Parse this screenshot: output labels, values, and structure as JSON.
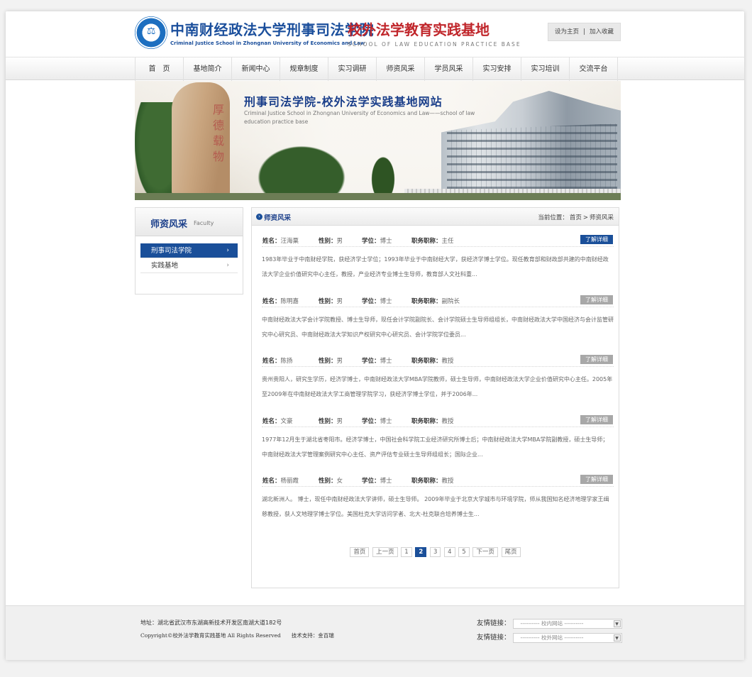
{
  "header": {
    "logo_cn": "中南财经政法大学刑事司法学院",
    "logo_cn_sub": "校外法学教育实践基地",
    "logo_en": "Criminal Justice School in Zhongnan University of Economics and Law",
    "logo_en_sub": "SCHOOL OF LAW EDUCATION PRACTICE BASE",
    "set_home": "设为主页",
    "separator": "|",
    "favorite": "加入收藏"
  },
  "nav": [
    "首　页",
    "基地简介",
    "新闻中心",
    "规章制度",
    "实习调研",
    "师资风采",
    "学员风采",
    "实习安排",
    "实习培训",
    "交流平台"
  ],
  "banner": {
    "title": "刑事司法学院-校外法学实践基地网站",
    "subtitle": "Criminal Justice School in Zhongnan University of Economics and Law——school of law education practice base",
    "rock_text": "厚德载物"
  },
  "sidebar": {
    "title": "师资风采",
    "title_en": "Faculty",
    "items": [
      {
        "label": "刑事司法学院",
        "arrow": "›"
      },
      {
        "label": "实践基地",
        "arrow": "›"
      }
    ]
  },
  "main": {
    "title": "师资风采",
    "breadcrumb_prefix": "当前位置：",
    "breadcrumb_home": "首页",
    "breadcrumb_sep": ">",
    "breadcrumb_current": "师资风采",
    "labels": {
      "name": "姓名：",
      "gender": "性别：",
      "degree": "学位：",
      "title": "职务职称："
    },
    "detail_label": "了解详细",
    "entries": [
      {
        "name": "汪海粟",
        "gender": "男",
        "degree": "博士",
        "title": "主任",
        "desc": "1983年毕业于中南财经学院，获经济学士学位；1993年毕业于中南财经大学，获经济学博士学位。现任教育部和财政部共建的中南财经政法大学企业价值研究中心主任，教授，产业经济专业博士生导师，教育部人文社科重..."
      },
      {
        "name": "陈明嘉",
        "gender": "男",
        "degree": "博士",
        "title": "副院长",
        "desc": "中南财经政法大学会计学院教授、博士生导师，现任会计学院副院长、会计学院硕士生导师组组长，中南财经政法大学中国经济与会计监管研究中心研究员、中南财经政法大学知识产权研究中心研究员、会计学院学位委员..."
      },
      {
        "name": "陈扬",
        "gender": "男",
        "degree": "博士",
        "title": "教授",
        "desc": "贵州贵阳人，研究生学历，经济学博士，中南财经政法大学MBA学院教师，硕士生导师，中南财经政法大学企业价值研究中心主任。2005年至2009年在中南财经政法大学工商管理学院学习，获经济学博士学位，并于2006年..."
      },
      {
        "name": "文豪",
        "gender": "男",
        "degree": "博士",
        "title": "教授",
        "desc": "1977年12月生于湖北省枣阳市。经济学博士，中国社会科学院工业经济研究所博士后；中南财经政法大学MBA学院副教授，硕士生导师；中南财经政法大学管理案例研究中心主任、资产评估专业硕士生导师组组长；国际企业..."
      },
      {
        "name": "杨丽霞",
        "gender": "女",
        "degree": "博士",
        "title": "教授",
        "desc": "湖北新洲人。 博士，现任中南财经政法大学讲师，硕士生导师。 2009年毕业于北京大学城市与环境学院，师从我国知名经济地理学家王缉慈教授，获人文地理学博士学位。美国杜克大学访问学者、北大-杜克联合培养博士生..."
      }
    ],
    "pager": {
      "first": "首页",
      "prev": "上一页",
      "pages": [
        "1",
        "2",
        "3",
        "4",
        "5"
      ],
      "current": "2",
      "next": "下一页",
      "last": "尾页"
    }
  },
  "footer": {
    "address": "地址：湖北省武汉市东湖高新技术开发区南湖大道182号",
    "copyright": "Copyright©校外法学教育实践基地 All Rights Reserved　　技术支持：金百瑞",
    "links_label": "友情链接：",
    "select1": "---------- 校内网站 ----------",
    "select2": "---------- 校外网站 ----------"
  },
  "colors": {
    "brand_blue": "#1a4f99",
    "brand_red": "#c0262b"
  }
}
